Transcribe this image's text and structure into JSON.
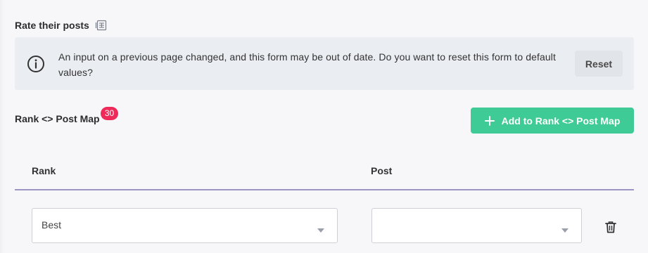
{
  "section": {
    "title": "Rate their posts",
    "title_icon": "form-icon"
  },
  "banner": {
    "icon": "info-icon",
    "message": "An input on a previous page changed, and this form may be out of date. Do you want to reset this form to default values?",
    "reset_label": "Reset"
  },
  "map": {
    "title": "Rank <> Post Map",
    "count": "30",
    "add_label": "Add to Rank <> Post Map",
    "add_icon": "plus-icon",
    "columns": {
      "rank": "Rank",
      "post": "Post"
    },
    "rows": [
      {
        "rank": "Best",
        "post": ""
      }
    ]
  },
  "colors": {
    "accent_green": "#3ecb96",
    "badge_red": "#ee2a5a",
    "rule_purple": "#9e95c2",
    "banner_bg": "#eaedf1"
  }
}
